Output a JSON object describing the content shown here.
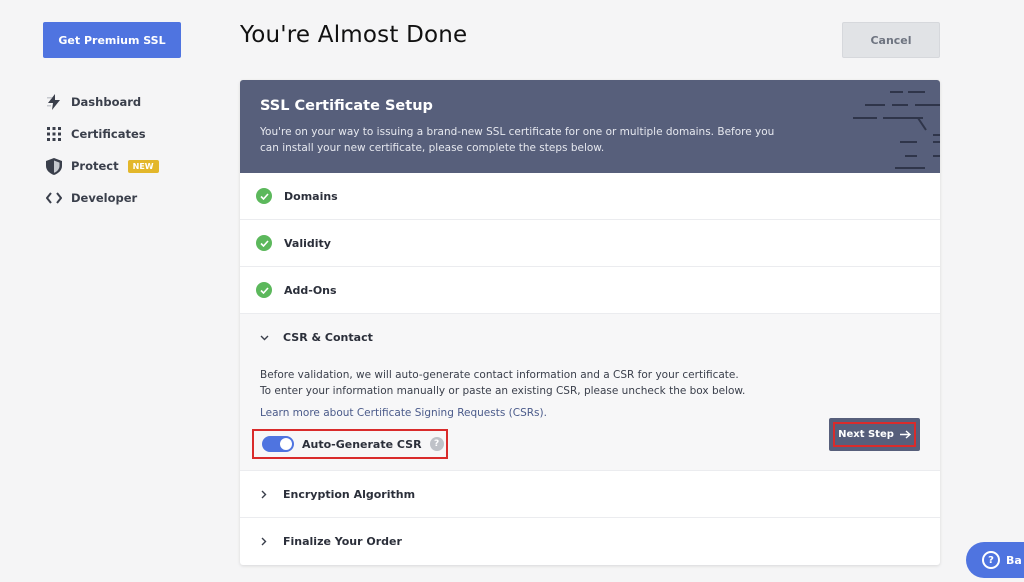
{
  "sidebar": {
    "premium_button": "Get Premium SSL",
    "items": [
      {
        "label": "Dashboard",
        "icon": "lightning-icon"
      },
      {
        "label": "Certificates",
        "icon": "grid-icon"
      },
      {
        "label": "Protect",
        "icon": "shield-icon",
        "badge": "NEW"
      },
      {
        "label": "Developer",
        "icon": "code-icon"
      }
    ]
  },
  "header": {
    "title": "You're Almost Done",
    "cancel_label": "Cancel"
  },
  "card": {
    "title": "SSL Certificate Setup",
    "description": "You're on your way to issuing a brand-new SSL certificate for one or multiple domains. Before you can install your new certificate, please complete the steps below.",
    "steps_done": [
      "Domains",
      "Validity",
      "Add-Ons"
    ],
    "current_step": {
      "label": "CSR & Contact",
      "text_line1": "Before validation, we will auto-generate contact information and a CSR for your certificate.",
      "text_line2": "To enter your information manually or paste an existing CSR, please uncheck the box below.",
      "learn_link": "Learn more about Certificate Signing Requests (CSRs).",
      "toggle_label": "Auto-Generate CSR",
      "toggle_on": true,
      "help_glyph": "?",
      "next_label": "Next Step"
    },
    "steps_pending": [
      "Encryption Algorithm",
      "Finalize Your Order"
    ]
  },
  "help_bubble": {
    "label": "Ba",
    "glyph": "?"
  },
  "colors": {
    "accent": "#4f74e0",
    "header_bg": "#575f7b",
    "success": "#5cb85c",
    "badge": "#e3b72b",
    "highlight": "#d92b2b"
  }
}
